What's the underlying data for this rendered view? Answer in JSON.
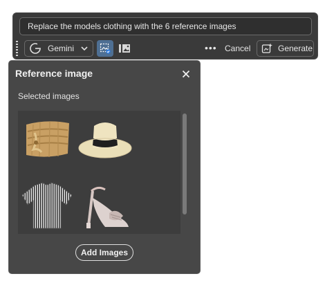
{
  "prompt": {
    "text": "Replace the models clothing with the 6 reference images"
  },
  "toolbar": {
    "model_label": "Gemini",
    "more_label": "•••",
    "cancel_label": "Cancel",
    "generate_label": "Generate",
    "icons": {
      "model": "gemini-logo-icon",
      "model_dropdown": "chevron-down-icon",
      "reference": "reference-image-icon",
      "image_add": "image-add-icon",
      "generate": "generate-sparkle-icon",
      "grip": "drag-grip-icon"
    }
  },
  "panel": {
    "title": "Reference image",
    "subtitle": "Selected images",
    "add_label": "Add Images",
    "close_icon": "close-icon",
    "images": [
      {
        "name": "straw-bag-icon"
      },
      {
        "name": "straw-hat-icon"
      },
      {
        "name": "striped-shirt-icon"
      },
      {
        "name": "heeled-sandal-icon"
      }
    ]
  },
  "colors": {
    "toolbar_bg": "#3a3a3a",
    "panel_bg": "#474747",
    "active_button": "#4e6f93"
  }
}
